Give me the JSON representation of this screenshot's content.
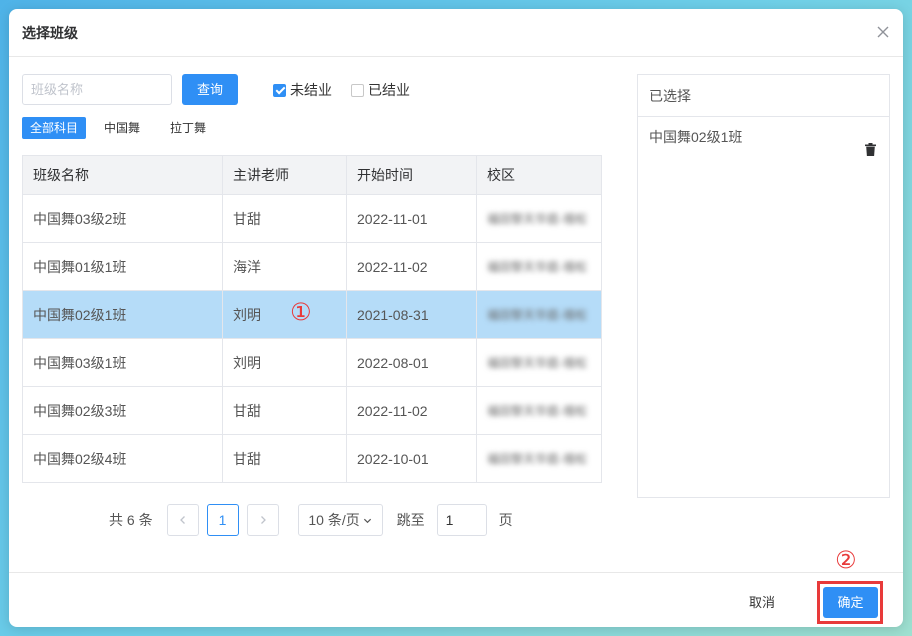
{
  "dialog": {
    "title": "选择班级",
    "close_icon": "close-icon"
  },
  "filters": {
    "search_placeholder": "班级名称",
    "search_value": "",
    "query_label": "查询",
    "unfinished_label": "未结业",
    "unfinished_checked": true,
    "finished_label": "已结业",
    "finished_checked": false,
    "subject_tabs": [
      "全部科目",
      "中国舞",
      "拉丁舞"
    ],
    "active_subject": "全部科目"
  },
  "table": {
    "headers": [
      "班级名称",
      "主讲老师",
      "开始时间",
      "校区"
    ],
    "rows": [
      {
        "name": "中国舞03级2班",
        "teacher": "甘甜",
        "start": "2022-11-01",
        "campus": "福田黎天华庭-禧松"
      },
      {
        "name": "中国舞01级1班",
        "teacher": "海洋",
        "start": "2022-11-02",
        "campus": "福田黎天华庭-禧松"
      },
      {
        "name": "中国舞02级1班",
        "teacher": "刘明",
        "start": "2021-08-31",
        "campus": "福田黎天华庭-禧松"
      },
      {
        "name": "中国舞03级1班",
        "teacher": "刘明",
        "start": "2022-08-01",
        "campus": "福田黎天华庭-禧松"
      },
      {
        "name": "中国舞02级3班",
        "teacher": "甘甜",
        "start": "2022-11-02",
        "campus": "福田黎天华庭-禧松"
      },
      {
        "name": "中国舞02级4班",
        "teacher": "甘甜",
        "start": "2022-10-01",
        "campus": "福田黎天华庭-禧松"
      }
    ],
    "selected_row_index": 2
  },
  "pagination": {
    "total_text": "共 6 条",
    "current_page": "1",
    "page_size_label": "10 条/页",
    "goto_label": "跳至",
    "goto_value": "1",
    "page_unit": "页"
  },
  "selected_panel": {
    "title": "已选择",
    "items": [
      "中国舞02级1班"
    ]
  },
  "footer": {
    "cancel_label": "取消",
    "confirm_label": "确定"
  },
  "annotations": {
    "step1": "①",
    "step2": "②",
    "color": "#e83a3a"
  },
  "colors": {
    "primary": "#2f8ff5",
    "selected_row": "#b5dcf8"
  }
}
